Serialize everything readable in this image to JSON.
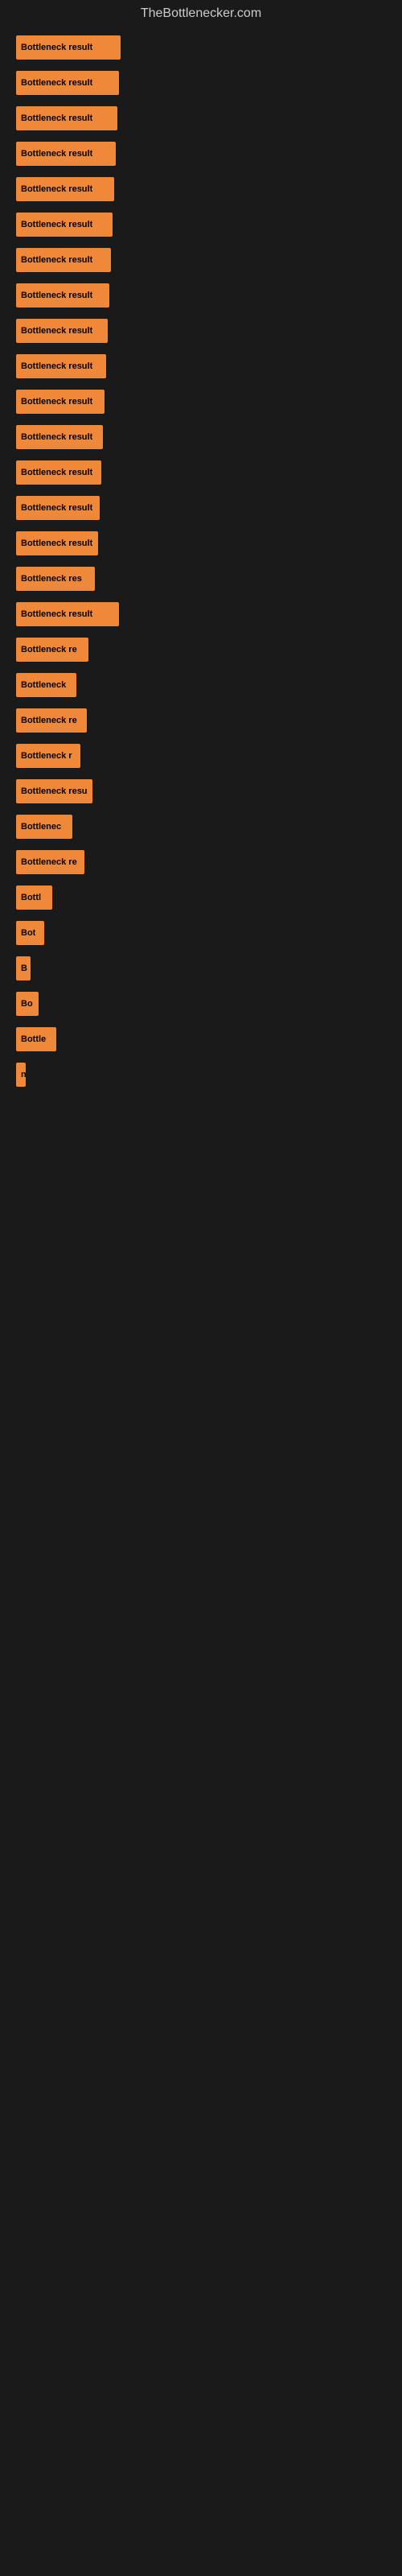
{
  "site": {
    "title": "TheBottlenecker.com"
  },
  "bars": [
    {
      "label": "Bottleneck result",
      "width": 130
    },
    {
      "label": "Bottleneck result",
      "width": 128
    },
    {
      "label": "Bottleneck result",
      "width": 126
    },
    {
      "label": "Bottleneck result",
      "width": 124
    },
    {
      "label": "Bottleneck result",
      "width": 122
    },
    {
      "label": "Bottleneck result",
      "width": 120
    },
    {
      "label": "Bottleneck result",
      "width": 118
    },
    {
      "label": "Bottleneck result",
      "width": 116
    },
    {
      "label": "Bottleneck result",
      "width": 114
    },
    {
      "label": "Bottleneck result",
      "width": 112
    },
    {
      "label": "Bottleneck result",
      "width": 110
    },
    {
      "label": "Bottleneck result",
      "width": 108
    },
    {
      "label": "Bottleneck result",
      "width": 106
    },
    {
      "label": "Bottleneck result",
      "width": 104
    },
    {
      "label": "Bottleneck result",
      "width": 102
    },
    {
      "label": "Bottleneck res",
      "width": 98
    },
    {
      "label": "Bottleneck result",
      "width": 128
    },
    {
      "label": "Bottleneck re",
      "width": 90
    },
    {
      "label": "Bottleneck",
      "width": 75
    },
    {
      "label": "Bottleneck re",
      "width": 88
    },
    {
      "label": "Bottleneck r",
      "width": 80
    },
    {
      "label": "Bottleneck resu",
      "width": 95
    },
    {
      "label": "Bottlenec",
      "width": 70
    },
    {
      "label": "Bottleneck re",
      "width": 85
    },
    {
      "label": "Bottl",
      "width": 45
    },
    {
      "label": "Bot",
      "width": 35
    },
    {
      "label": "B",
      "width": 18
    },
    {
      "label": "Bo",
      "width": 28
    },
    {
      "label": "Bottle",
      "width": 50
    },
    {
      "label": "n",
      "width": 12
    },
    {
      "label": "",
      "width": 0
    },
    {
      "label": "",
      "width": 0
    },
    {
      "label": "",
      "width": 0
    },
    {
      "label": "",
      "width": 0
    }
  ]
}
